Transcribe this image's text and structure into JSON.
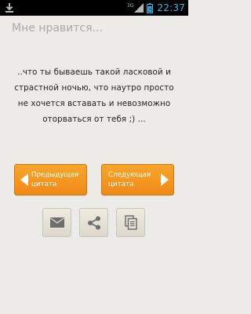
{
  "status_bar": {
    "network_type": "3G",
    "time": "22:37",
    "icons": [
      "download-icon",
      "signal-icon",
      "battery-icon"
    ]
  },
  "page": {
    "title": "Мне нравится..."
  },
  "quote": {
    "lines": [
      "..что ты бываешь такой ласковой и",
      "страстной ночью, что наутро просто",
      "не хочется вставать и невозможно",
      "оторваться от тебя ;) ..."
    ]
  },
  "navigation": {
    "prev": {
      "line1": "Предыдущая",
      "line2": "цитата",
      "icon": "arrow-left-icon"
    },
    "next": {
      "line1": "Следующая",
      "line2": "цитата",
      "icon": "arrow-right-icon"
    }
  },
  "actions": [
    {
      "name": "email",
      "icon": "mail-icon"
    },
    {
      "name": "share",
      "icon": "share-icon"
    },
    {
      "name": "copy",
      "icon": "copy-icon"
    }
  ],
  "colors": {
    "accent_orange": "#f39218",
    "status_time": "#33b5e5",
    "background": "#ecebe8",
    "title_gray": "#a9a9a9",
    "action_icon_gray": "#6e6e6e"
  }
}
